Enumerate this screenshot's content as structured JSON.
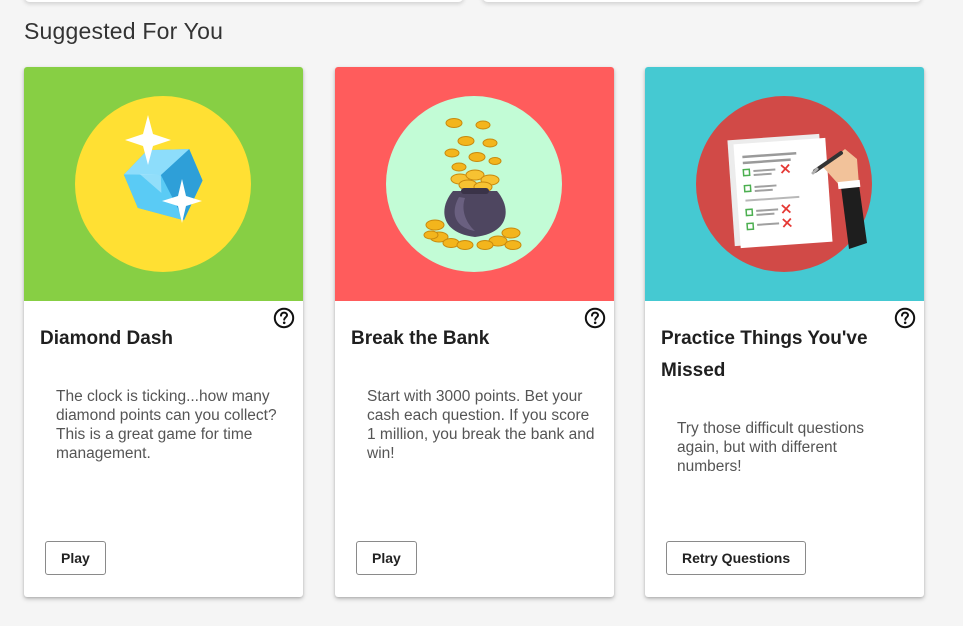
{
  "section": {
    "title": "Suggested For You"
  },
  "cards": [
    {
      "title": "Diamond Dash",
      "description": "The clock is ticking...how many diamond points can you collect? This is a great game for time management.",
      "button_label": "Play",
      "banner_color": "#87CF44",
      "circle_color": "#FFE033",
      "illustration": "diamond-icon"
    },
    {
      "title": "Break the Bank",
      "description": "Start with 3000 points. Bet your cash each question. If you score 1 million, you break the bank and win!",
      "button_label": "Play",
      "banner_color": "#FF5C5C",
      "circle_color": "#C2FCD6",
      "illustration": "money-bag-icon"
    },
    {
      "title": "Practice Things You've Missed",
      "description": "Try those difficult questions again, but with different numbers!",
      "button_label": "Retry Questions",
      "banner_color": "#45C9D2",
      "circle_color": "#D14A47",
      "illustration": "graded-paper-icon"
    }
  ],
  "icons": {
    "help": "help-circle-icon"
  }
}
